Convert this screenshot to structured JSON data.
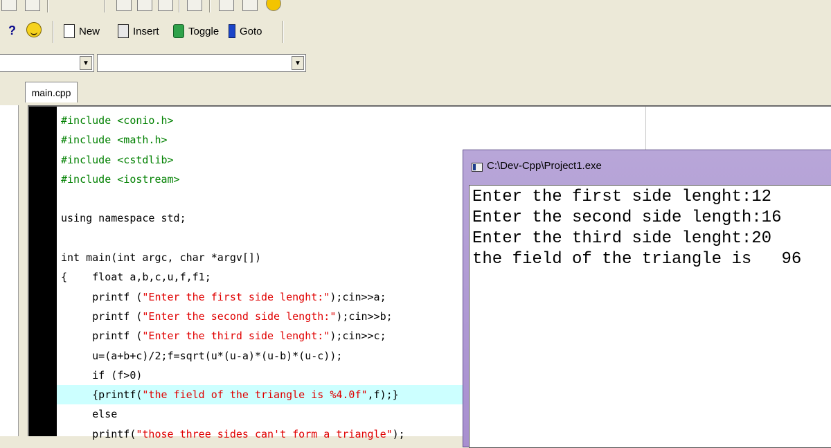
{
  "toolbar": {
    "new_label": "New",
    "insert_label": "Insert",
    "toggle_label": "Toggle",
    "goto_label": "Goto",
    "help_glyph": "?"
  },
  "editor": {
    "tab_label": "main.cpp",
    "lines": [
      "#include <conio.h>",
      "#include <math.h>",
      "#include <cstdlib>",
      "#include <iostream>",
      "",
      "using namespace std;",
      "",
      "int main(int argc, char *argv[])",
      "{    float a,b,c,u,f,f1;",
      "     printf (",
      "     printf (",
      "     printf (",
      "     u=(a+b+c)/2;f=sqrt(u*(u-a)*(u-b)*(u-c));",
      "     if (f>0)",
      "     {printf(",
      "     else",
      "     printf("
    ],
    "strings": [
      "\"Enter the first side lenght:\"",
      "\"Enter the second side length:\"",
      "\"Enter the third side lenght:\"",
      "\"the field of the triangle is %4.0f\"",
      "\"those three sides can't form a triangle\""
    ],
    "tails": [
      ");cin>>a;",
      ");cin>>b;",
      ");cin>>c;",
      ",f);}",
      ");"
    ]
  },
  "console": {
    "title": "C:\\Dev-Cpp\\Project1.exe",
    "lines": [
      "Enter the first side lenght:12",
      "Enter the second side length:16",
      "Enter the third side lenght:20",
      "the field of the triangle is   96"
    ]
  }
}
